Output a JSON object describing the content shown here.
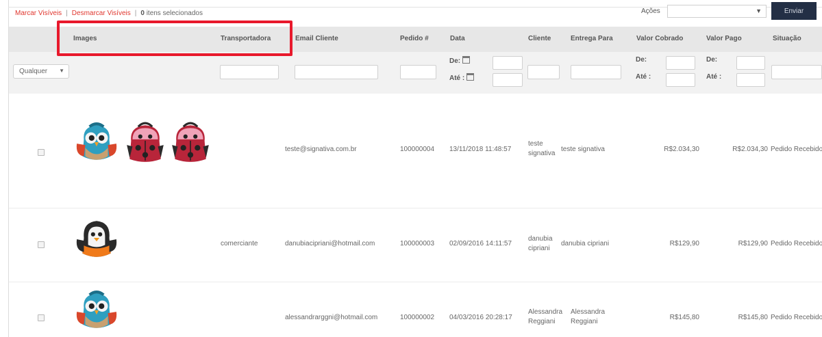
{
  "toolbar": {
    "select_visible": "Marcar Visíveis",
    "separator": "|",
    "unselect_visible": "Desmarcar Visíveis",
    "selected_count": "0",
    "selected_suffix": "itens selecionados"
  },
  "actions": {
    "label": "Ações",
    "select_value": "",
    "submit_label": "Enviar"
  },
  "columns": [
    "Images",
    "Transportadora",
    "Email Cliente",
    "Pedido #",
    "Data",
    "Cliente",
    "Entrega Para",
    "Valor Cobrado",
    "Valor Pago",
    "Situação"
  ],
  "filters": {
    "image_select": "Qualquer",
    "from_label": "De:",
    "to_label": "Até :"
  },
  "rows": [
    {
      "images": [
        "backpack-owl-icon",
        "backpack-ladybug-icon",
        "backpack-ladybug-icon"
      ],
      "carrier": "",
      "email": "teste@signativa.com.br",
      "order": "100000004",
      "date": "13/11/2018 11:48:57",
      "customer": [
        "teste",
        "signativa"
      ],
      "ship_to": "teste signativa",
      "charged": "R$2.034,30",
      "paid": "R$2.034,30",
      "status": "Pedido Recebido"
    },
    {
      "images": [
        "backpack-penguin-icon"
      ],
      "carrier": "comerciante",
      "email": "danubiacipriani@hotmail.com",
      "order": "100000003",
      "date": "02/09/2016 14:11:57",
      "customer": [
        "danubia",
        "cipriani"
      ],
      "ship_to": "danubia cipriani",
      "charged": "R$129,90",
      "paid": "R$129,90",
      "status": "Pedido Recebido"
    },
    {
      "images": [
        "backpack-owl-icon"
      ],
      "carrier": "",
      "email": "alessandrarggni@hotmail.com",
      "order": "100000002",
      "date": "04/03/2016 20:28:17",
      "customer": [
        "Alessandra",
        "Reggiani"
      ],
      "ship_to": [
        "Alessandra",
        "Reggiani"
      ],
      "charged": "R$145,80",
      "paid": "R$145,80",
      "status": "Pedido Recebido"
    }
  ],
  "colors": {
    "link": "#e0362e",
    "highlight": "#e8192c",
    "header_bg": "#e7e7e7",
    "filter_bg": "#f2f2f2",
    "button_bg": "#232f45"
  }
}
